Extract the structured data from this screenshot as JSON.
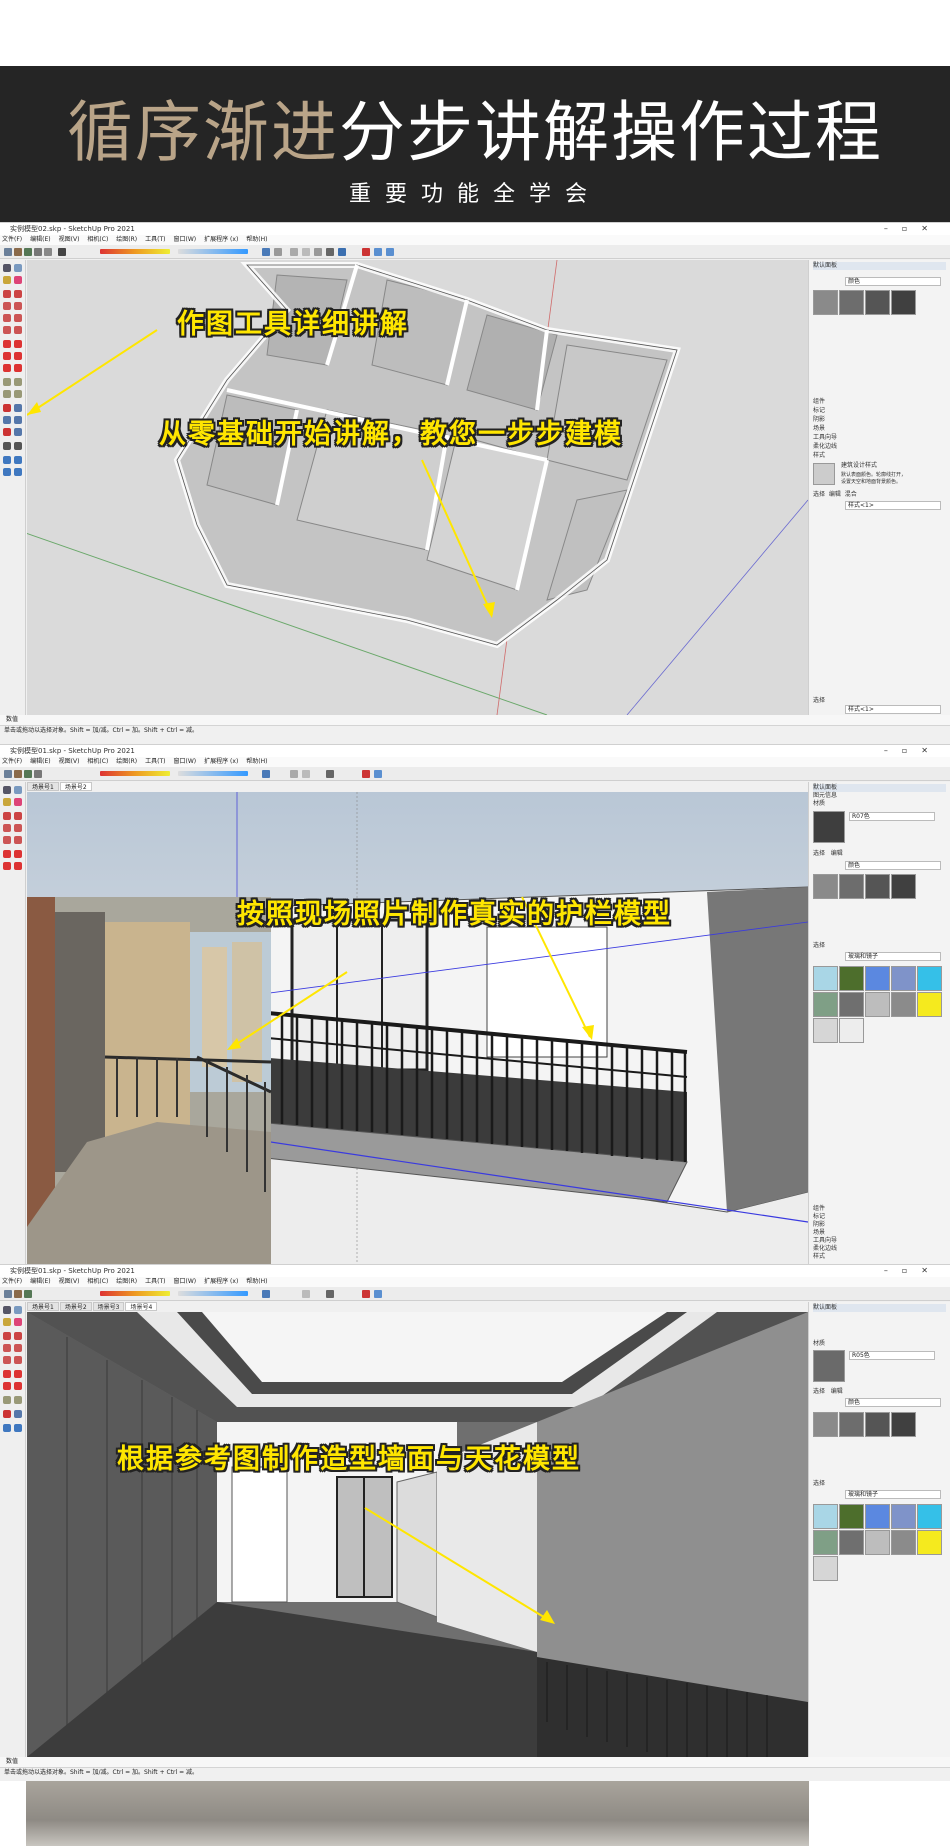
{
  "banner": {
    "title_gold": "循序渐进",
    "title_white": "分步讲解操作过程",
    "subtitle": "重要功能全学会"
  },
  "shot1": {
    "window_title": "实例模型02.skp - SketchUp Pro 2021",
    "menu": [
      "文件(F)",
      "编辑(E)",
      "视图(V)",
      "相机(C)",
      "绘图(R)",
      "工具(T)",
      "窗口(W)",
      "扩展程序 (x)",
      "帮助(H)"
    ],
    "caption_tools": "作图工具详细讲解",
    "caption_steps": "从零基础开始讲解，教您一步步建模",
    "panel": {
      "title": "默认面板",
      "material_label": "颜色",
      "sections": [
        "组件",
        "标记",
        "阴影",
        "场景",
        "工具向导",
        "柔化边线",
        "样式"
      ],
      "style_name": "建筑设计样式",
      "style_desc": "默认表面颜色。轮廓线打开，\n设置天空和地面背景颜色。",
      "style_tabs": [
        "选择",
        "编辑",
        "混合"
      ],
      "style_field": "样式<1>",
      "bottom_label": "选择",
      "bottom_field": "样式<1>"
    },
    "measure_label": "数值",
    "status": "单击或拖动以选择对象。Shift = 加/减。Ctrl = 加。Shift + Ctrl = 减。"
  },
  "shot2": {
    "window_title": "实例模型01.skp - SketchUp Pro 2021",
    "menu": [
      "文件(F)",
      "编辑(E)",
      "视图(V)",
      "相机(C)",
      "绘图(R)",
      "工具(T)",
      "窗口(W)",
      "扩展程序 (x)",
      "帮助(H)"
    ],
    "tabs": [
      "场景号1",
      "场景号2"
    ],
    "caption": "按照现场照片制作真实的护栏模型",
    "panel": {
      "title": "默认面板",
      "sections_top": [
        "图元信息",
        "材质"
      ],
      "material_name": "R07色",
      "tabs": [
        "选择",
        "编辑"
      ],
      "color_field": "颜色",
      "library_label": "选择",
      "library_field": "玻璃和镜子",
      "sections_bottom": [
        "组件",
        "标记",
        "阴影",
        "场景",
        "工具向导",
        "柔化边线",
        "样式"
      ]
    }
  },
  "shot3": {
    "window_title": "实例模型01.skp - SketchUp Pro 2021",
    "menu": [
      "文件(F)",
      "编辑(E)",
      "视图(V)",
      "相机(C)",
      "绘图(R)",
      "工具(T)",
      "窗口(W)",
      "扩展程序 (x)",
      "帮助(H)"
    ],
    "tabs": [
      "场景号1",
      "场景号2",
      "场景号3",
      "场景号4"
    ],
    "caption": "根据参考图制作造型墙面与天花模型",
    "panel": {
      "title": "默认面板",
      "sections_top": [
        "材质"
      ],
      "material_name": "R05色",
      "tabs": [
        "选择",
        "编辑"
      ],
      "color_field": "颜色",
      "library_label": "选择",
      "library_field": "玻璃和镜子"
    },
    "measure_label": "数值",
    "status": "单击或拖动以选择对象。Shift = 加/减。Ctrl = 加。Shift + Ctrl = 减。"
  },
  "colors": {
    "caption_yellow": "#ffe600",
    "banner_bg": "#252525",
    "banner_gold": "#b9a488"
  }
}
